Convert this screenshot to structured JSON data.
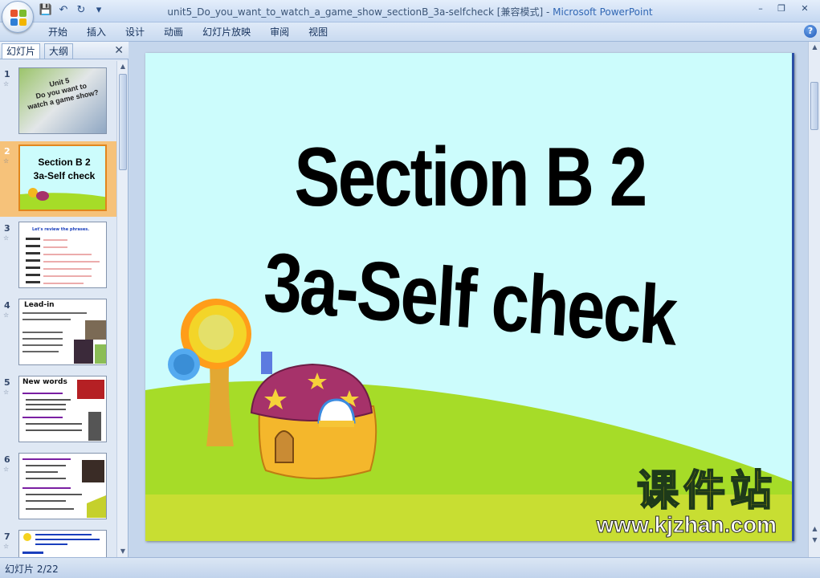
{
  "window": {
    "title_doc": "unit5_Do_you_want_to_watch_a_game_show_sectionB_3a-selfcheck [兼容模式]",
    "title_sep": " - ",
    "title_app": "Microsoft PowerPoint"
  },
  "ribbon": {
    "tabs": [
      "开始",
      "插入",
      "设计",
      "动画",
      "幻灯片放映",
      "审阅",
      "视图"
    ]
  },
  "pane": {
    "tabs": [
      "幻灯片",
      "大纲"
    ],
    "slides": [
      {
        "num": "1",
        "lines": [
          "Unit 5",
          "Do you want to",
          "watch a game show?"
        ]
      },
      {
        "num": "2",
        "lines": [
          "Section B 2",
          "3a-Self check"
        ]
      },
      {
        "num": "3",
        "lines": [
          "Let's review the phrases."
        ]
      },
      {
        "num": "4",
        "lines": [
          "Lead-in"
        ]
      },
      {
        "num": "5",
        "lines": [
          "New words"
        ]
      },
      {
        "num": "6",
        "lines": []
      },
      {
        "num": "7",
        "lines": []
      }
    ]
  },
  "slide": {
    "title_line1": "Section B 2",
    "title_line2": "3a-Self check",
    "watermark_cn": "课件站",
    "watermark_url": "www.kjzhan.com"
  },
  "status": {
    "slide_label": "幻灯片 2/22"
  },
  "colors": {
    "slide_bg": "#ccfcfc",
    "hill": "#a6dc28",
    "selected_thumb": "#f6c27a"
  }
}
